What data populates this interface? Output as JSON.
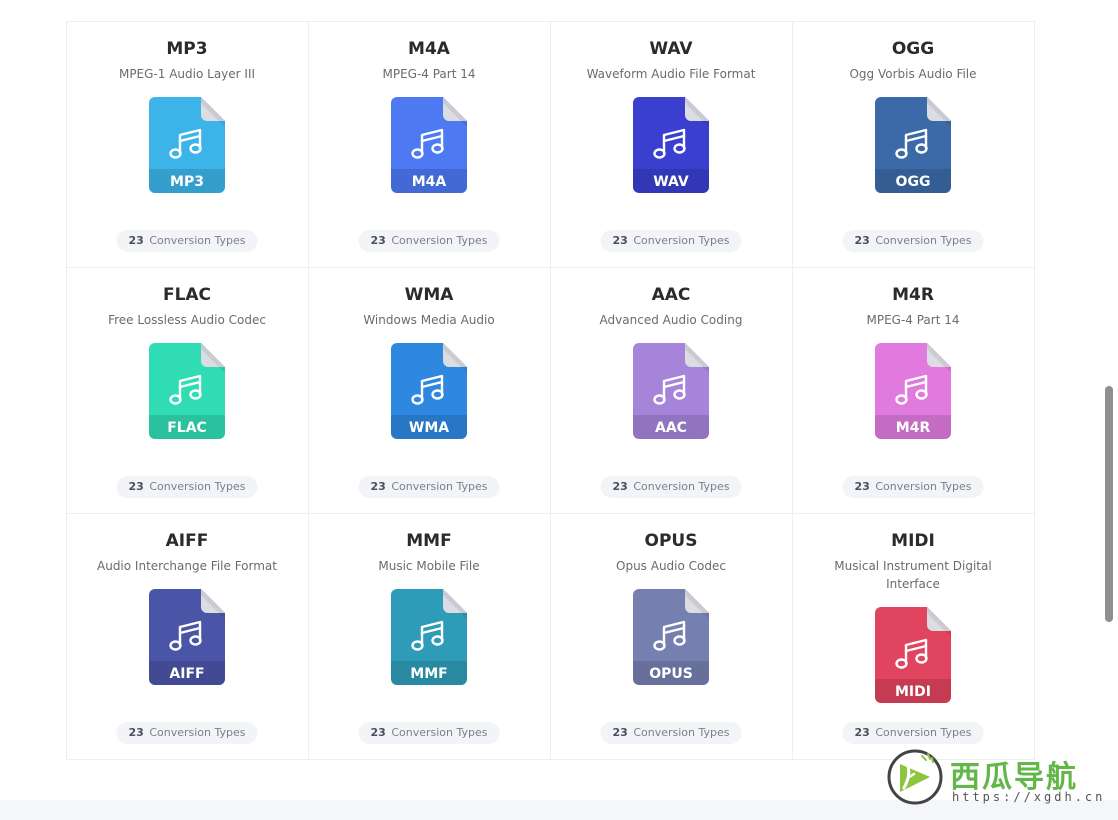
{
  "formats": [
    {
      "name": "MP3",
      "desc": "MPEG-1 Audio Layer III",
      "label": "MP3",
      "color": "#3cb4ea",
      "count": "23",
      "count_text": "Conversion Types"
    },
    {
      "name": "M4A",
      "desc": "MPEG-4 Part 14",
      "label": "M4A",
      "color": "#4d79f2",
      "count": "23",
      "count_text": "Conversion Types"
    },
    {
      "name": "WAV",
      "desc": "Waveform Audio File Format",
      "label": "WAV",
      "color": "#3a3fd0",
      "count": "23",
      "count_text": "Conversion Types"
    },
    {
      "name": "OGG",
      "desc": "Ogg Vorbis Audio File",
      "label": "OGG",
      "color": "#3c6aa8",
      "count": "23",
      "count_text": "Conversion Types"
    },
    {
      "name": "FLAC",
      "desc": "Free Lossless Audio Codec",
      "label": "FLAC",
      "color": "#2fdcb4",
      "count": "23",
      "count_text": "Conversion Types"
    },
    {
      "name": "WMA",
      "desc": "Windows Media Audio",
      "label": "WMA",
      "color": "#2e88e0",
      "count": "23",
      "count_text": "Conversion Types"
    },
    {
      "name": "AAC",
      "desc": "Advanced Audio Coding",
      "label": "AAC",
      "color": "#a684da",
      "count": "23",
      "count_text": "Conversion Types"
    },
    {
      "name": "M4R",
      "desc": "MPEG-4 Part 14",
      "label": "M4R",
      "color": "#e07ade",
      "count": "23",
      "count_text": "Conversion Types"
    },
    {
      "name": "AIFF",
      "desc": "Audio Interchange File Format",
      "label": "AIFF",
      "color": "#4a55a8",
      "count": "23",
      "count_text": "Conversion Types"
    },
    {
      "name": "MMF",
      "desc": "Music Mobile File",
      "label": "MMF",
      "color": "#2e9cb8",
      "count": "23",
      "count_text": "Conversion Types"
    },
    {
      "name": "OPUS",
      "desc": "Opus Audio Codec",
      "label": "OPUS",
      "color": "#7580b0",
      "count": "23",
      "count_text": "Conversion Types"
    },
    {
      "name": "MIDI",
      "desc": "Musical Instrument Digital Interface",
      "label": "MIDI",
      "color": "#e0445e",
      "count": "23",
      "count_text": "Conversion Types"
    }
  ],
  "watermark": {
    "name": "西瓜导航",
    "url": "https://xgdh.cn",
    "color": "#63b64a"
  },
  "icons": {
    "file": "music-file-icon",
    "note": "music-note-icon"
  }
}
